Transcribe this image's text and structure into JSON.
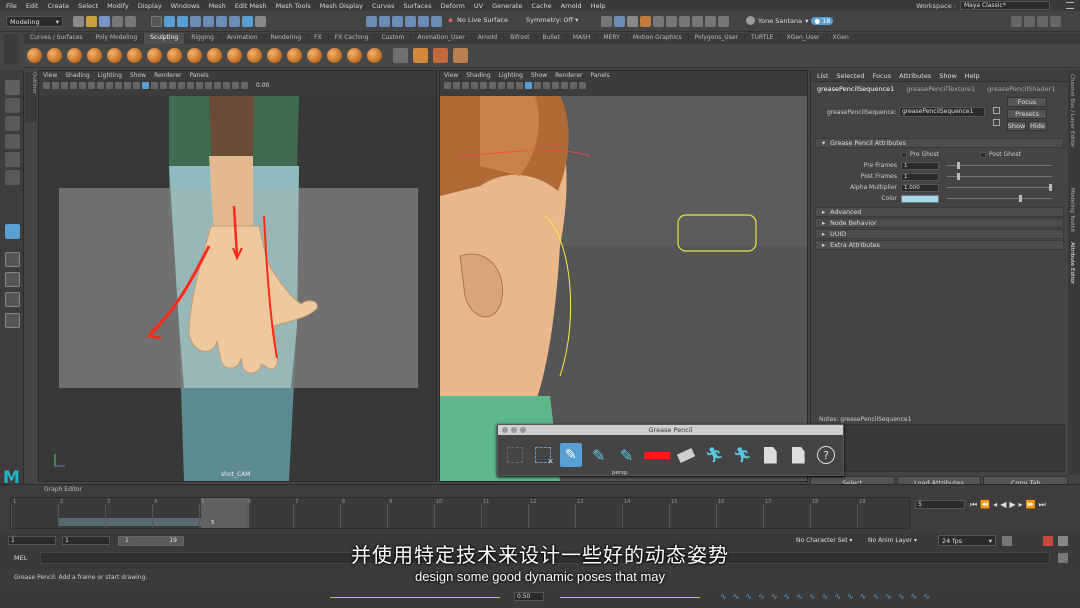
{
  "menu": [
    "File",
    "Edit",
    "Create",
    "Select",
    "Modify",
    "Display",
    "Windows",
    "Mesh",
    "Edit Mesh",
    "Mesh Tools",
    "Mesh Display",
    "Curves",
    "Surfaces",
    "Deform",
    "UV",
    "Generate",
    "Cache",
    "Arnold",
    "Help"
  ],
  "workspace": {
    "label": "Workspace :",
    "value": "Maya Classic*"
  },
  "status": {
    "mode": "Modeling",
    "live_surface": "No Live Surface",
    "symmetry": "Symmetry: Off",
    "user": "Yone Santana",
    "badge": "18"
  },
  "shelf_tabs": [
    "Curves / Surfaces",
    "Poly Modeling",
    "Sculpting",
    "Rigging",
    "Animation",
    "Rendering",
    "FX",
    "FX Caching",
    "Custom",
    "Animation_User",
    "Arnold",
    "Bifrost",
    "Bullet",
    "MASH",
    "MERY",
    "Motion Graphics",
    "Polygons_User",
    "TURTLE",
    "XGen_User",
    "XGen"
  ],
  "shelf_active": "Sculpting",
  "viewport_menu": [
    "View",
    "Shading",
    "Lighting",
    "Show",
    "Renderer",
    "Panels"
  ],
  "viewport_left": {
    "camera": "shot_CAM",
    "value": "0.00",
    "outliner": "Outliner"
  },
  "viewport_right": {
    "camera": "persp"
  },
  "attr_editor": {
    "menu": [
      "List",
      "Selected",
      "Focus",
      "Attributes",
      "Show",
      "Help"
    ],
    "tabs": [
      "greasePencilSequence1",
      "greasePencilTexture1",
      "greasePencilShader1"
    ],
    "node_label": "greasePencilSequence:",
    "node_value": "greasePencilSequence1",
    "focus": "Focus",
    "presets": "Presets",
    "show": "Show",
    "hide": "Hide",
    "section": "Grease Pencil Attributes",
    "pre_ghost": "Pre Ghost",
    "post_ghost": "Post Ghost",
    "rows": [
      {
        "label": "Pre Frames",
        "value": "1"
      },
      {
        "label": "Post Frames",
        "value": "1"
      },
      {
        "label": "Alpha Multiplier",
        "value": "1.000"
      },
      {
        "label": "Color",
        "value": ""
      }
    ],
    "collapsed": [
      "Advanced",
      "Node Behavior",
      "UUID",
      "Extra Attributes"
    ],
    "notes": "Notes:  greasePencilSequence1",
    "buttons": [
      "Select",
      "Load Attributes",
      "Copy Tab"
    ]
  },
  "side_tabs": [
    "Channel Box / Layer Editor",
    "Modeling Toolkit",
    "Attribute Editor"
  ],
  "grease_pencil": {
    "title": "Grease Pencil",
    "help": "?"
  },
  "graph_editor": "Graph Editor",
  "timeline": {
    "ticks": [
      "1",
      "2",
      "3",
      "4",
      "5",
      "6",
      "7",
      "8",
      "9",
      "10",
      "11",
      "12",
      "13",
      "14",
      "15",
      "16",
      "17",
      "18",
      "19"
    ],
    "current": "5",
    "current_field": "5"
  },
  "range": {
    "start": "1",
    "start2": "1",
    "inner_start": "1",
    "inner_end": "19",
    "char_set": "No Character Set",
    "anim_layer": "No Anim Layer",
    "fps": "24 fps"
  },
  "cmd": {
    "label": "MEL"
  },
  "help_line": "Grease Pencil: Add a frame or start drawing.",
  "bottom_value": "0.50",
  "subtitle_cn": "并使用特定技术来设计一些好的动态姿势",
  "subtitle_en": "design some good dynamic poses that may",
  "colors": {
    "accent": "#5a9fd4",
    "pencil_red": "#ff1a1a",
    "attr_color": "#a8d8f0"
  }
}
